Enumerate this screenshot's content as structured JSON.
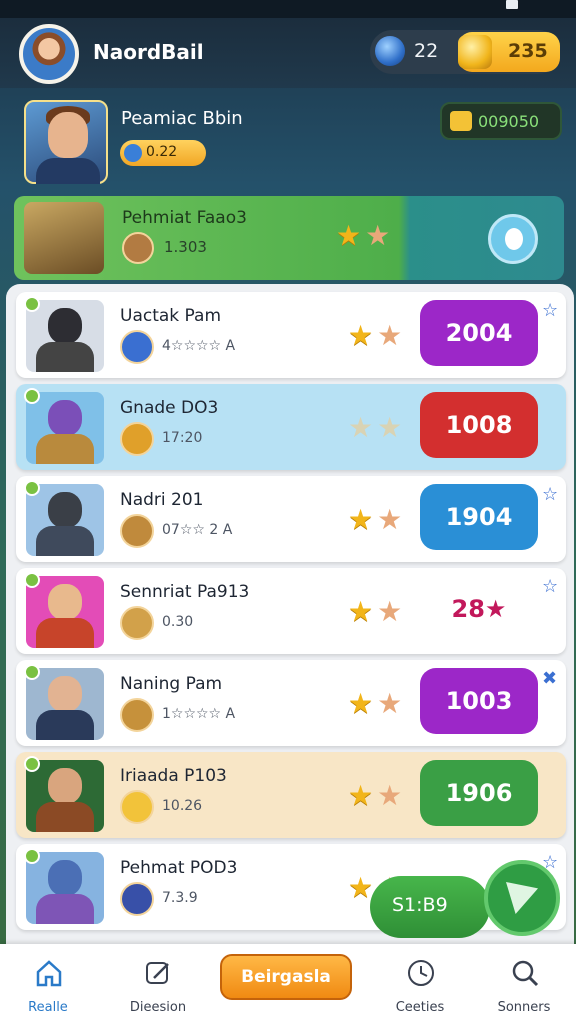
{
  "header": {
    "title": "NaordBail",
    "gems": "22",
    "coins": "235",
    "avatar_icon": "player-avatar-icon",
    "gem_icon": "blue-gem-icon",
    "coin_icon": "gold-coin-icon"
  },
  "featured": {
    "name": "Peamiac Bbin",
    "pill_value": "0.22",
    "badge_value": "009050"
  },
  "highlighted": {
    "name": "Pehmiat Faao3",
    "sub": "1.303",
    "stars_filled": 1,
    "stars_total": 2
  },
  "rows": [
    {
      "name": "Uactak Pam",
      "sub": "4☆☆☆☆ A",
      "score": "2004",
      "score_color": "#9c27c8",
      "stars": [
        "gold",
        "peach"
      ],
      "row_bg": "#ffffff",
      "corner": "☆"
    },
    {
      "name": "Gnade DO3",
      "sub": "17:20",
      "score": "1008",
      "score_color": "#d32f2f",
      "stars": [
        "dim",
        "dim"
      ],
      "row_bg": "#b7e1f4",
      "corner": ""
    },
    {
      "name": "Nadri 201",
      "sub": "07☆☆ 2 A",
      "score": "1904",
      "score_color": "#2a8fd6",
      "stars": [
        "gold",
        "peach"
      ],
      "row_bg": "#ffffff",
      "corner": "☆"
    },
    {
      "name": "Sennriat Pa913",
      "sub": "0.30",
      "score": "28★",
      "score_color": "transparent",
      "stars": [
        "gold",
        "peach"
      ],
      "row_bg": "#ffffff",
      "corner": "☆"
    },
    {
      "name": "Naning Pam",
      "sub": "1☆☆☆☆ A",
      "score": "1003",
      "score_color": "#9c27c8",
      "stars": [
        "gold",
        "peach"
      ],
      "row_bg": "#ffffff",
      "corner": "✖"
    },
    {
      "name": "Iriaada P103",
      "sub": "10.26",
      "score": "1906",
      "score_color": "#3a9f45",
      "stars": [
        "gold",
        "peach"
      ],
      "row_bg": "#f8e6c6",
      "corner": ""
    },
    {
      "name": "Pehmat POD3",
      "sub": "7.3.9",
      "score": "",
      "score_color": "transparent",
      "stars": [
        "gold",
        "peach"
      ],
      "row_bg": "#ffffff",
      "corner": "☆"
    }
  ],
  "float_cta": {
    "label": "S1:B9"
  },
  "nav": {
    "items": [
      {
        "label": "Realle",
        "icon": "home-icon"
      },
      {
        "label": "Dieesion",
        "icon": "edit-icon"
      },
      {
        "label": "Ceeties",
        "icon": "clock-icon"
      },
      {
        "label": "Sonners",
        "icon": "search-icon"
      }
    ],
    "cta_label": "Beirgasla"
  }
}
